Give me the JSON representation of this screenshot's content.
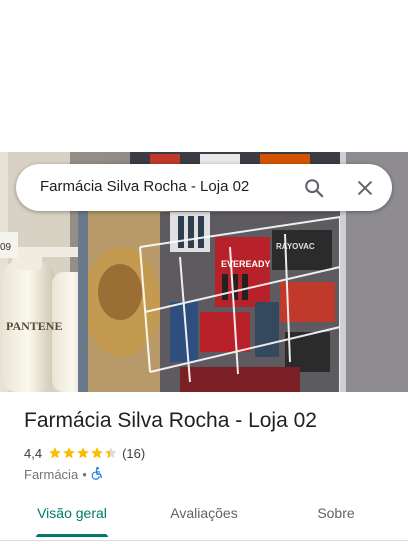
{
  "search": {
    "query": "Farmácia Silva Rocha - Loja 02"
  },
  "place": {
    "name": "Farmácia Silva Rocha - Loja 02",
    "rating": "4,4",
    "rating_stars": 4.4,
    "reviews": "(16)",
    "category": "Farmácia",
    "separator": "•",
    "accessibility_icon": "wheelchair-icon"
  },
  "tabs": [
    {
      "label": "Visão geral",
      "active": true
    },
    {
      "label": "Avaliações",
      "active": false
    },
    {
      "label": "Sobre",
      "active": false
    }
  ],
  "hero": {
    "product_texts": [
      "PANTENE",
      "EVEREADY",
      "RAYOVAC"
    ]
  },
  "colors": {
    "accent": "#00796b",
    "star": "#fbbc04",
    "accessibility": "#1a73e8"
  }
}
